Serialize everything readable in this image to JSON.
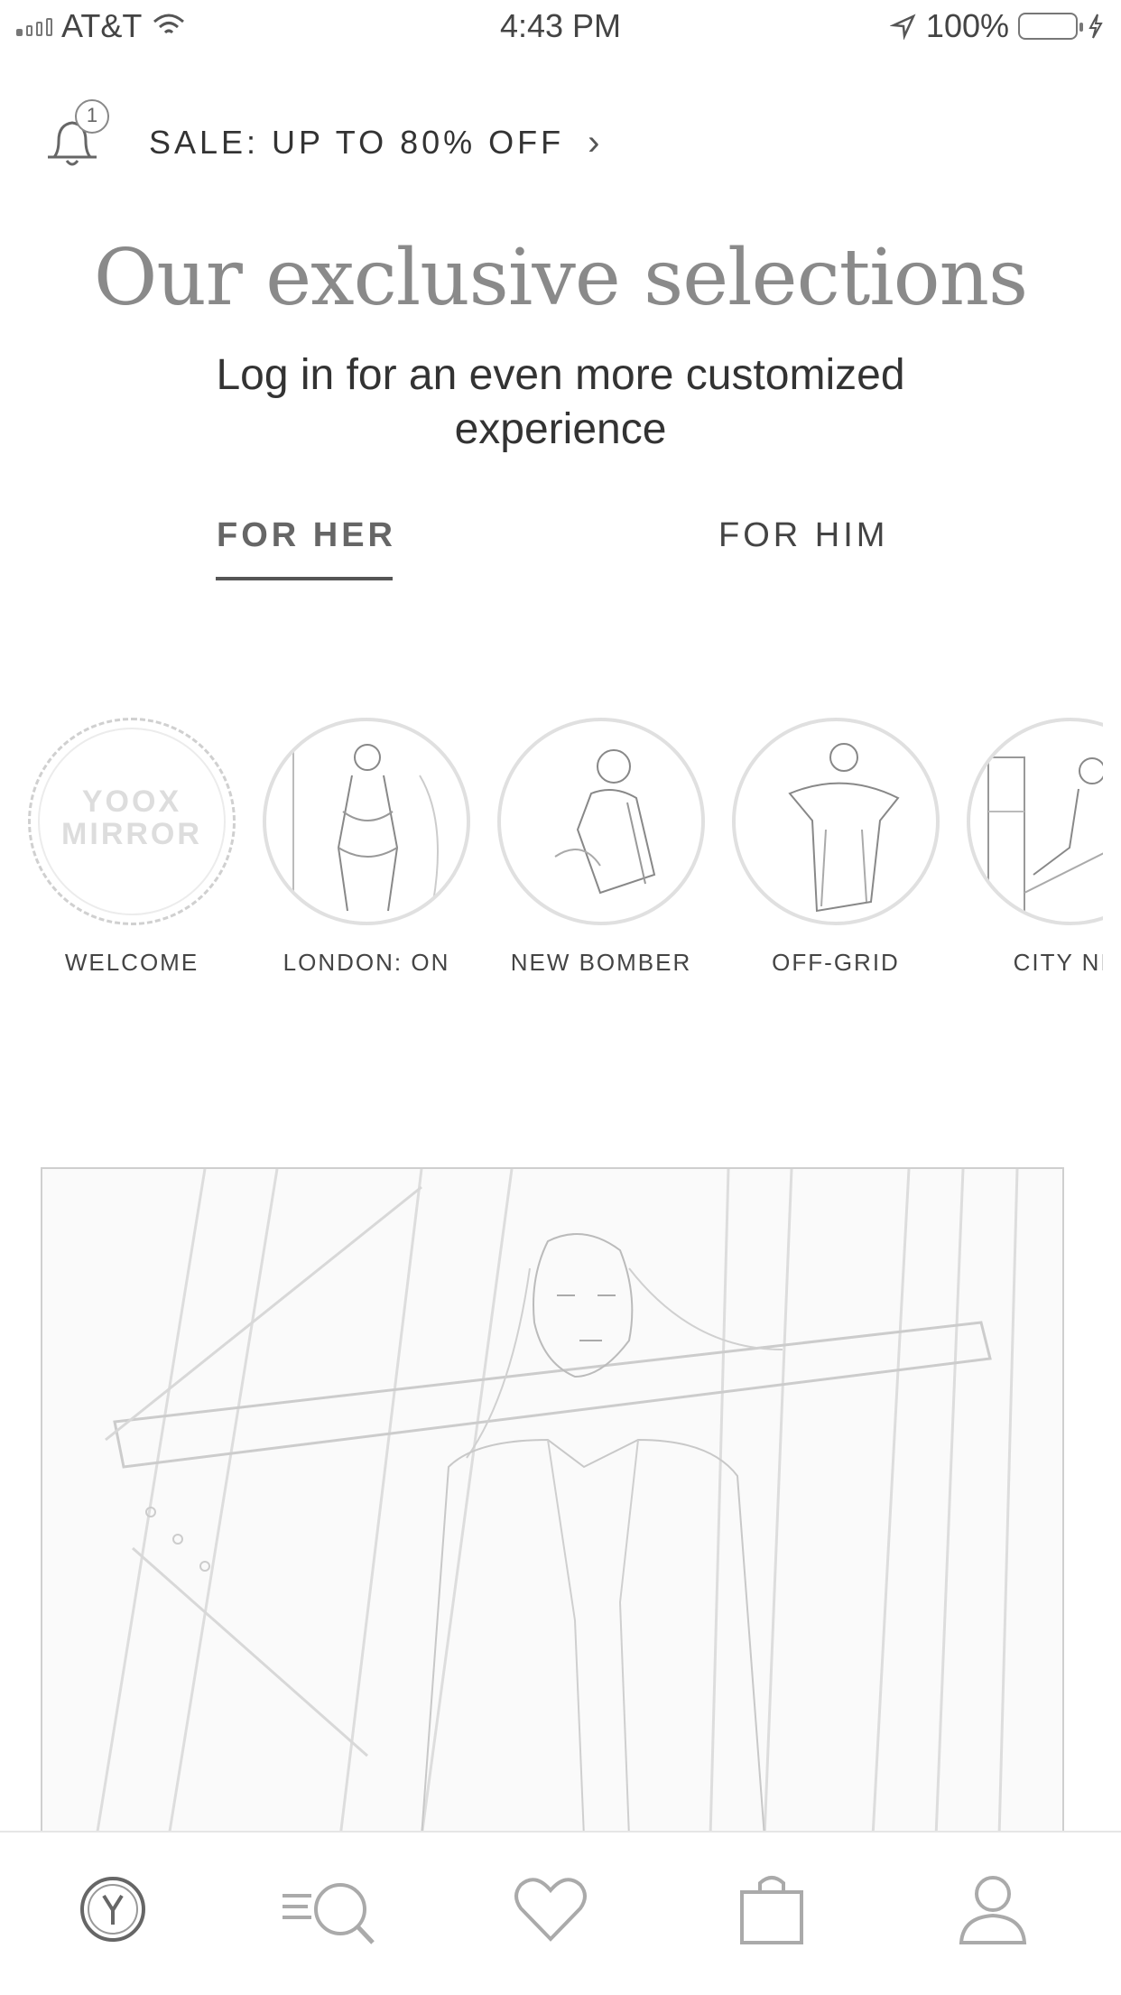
{
  "status_bar": {
    "carrier": "AT&T",
    "time": "4:43 PM",
    "battery": "100%"
  },
  "sale_banner": {
    "badge_count": "1",
    "text": "SALE: UP TO 80% OFF",
    "chevron_icon": "chevron-right-icon"
  },
  "hero": {
    "title": "Our exclusive selections",
    "subtitle": "Log in for an even more customized experience"
  },
  "tabs": [
    {
      "label": "FOR HER",
      "selected": true
    },
    {
      "label": "FOR HIM",
      "selected": false
    }
  ],
  "welcome_logo": {
    "line1": "YOOX",
    "line2": "MIRROR"
  },
  "stories": [
    {
      "label": "WELCOME"
    },
    {
      "label": "LONDON: ON"
    },
    {
      "label": "NEW BOMBER"
    },
    {
      "label": "OFF-GRID"
    },
    {
      "label": "CITY NIC"
    }
  ],
  "tabbar": {
    "items": [
      "home-logo-icon",
      "menu-search-icon",
      "heart-icon",
      "shopping-bag-icon",
      "profile-icon"
    ]
  },
  "colors": {
    "text": "#3a3a3a",
    "muted": "#8a8a8a",
    "line": "#cfcfcf"
  }
}
